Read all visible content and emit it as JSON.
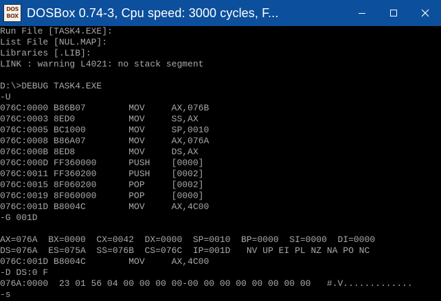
{
  "window": {
    "title": "DOSBox 0.74-3, Cpu speed:      3000 cycles, F...",
    "icon_top": "DOS",
    "icon_bottom": "BOX",
    "icon_name": "dosbox-icon",
    "controls": [
      "minimize-icon",
      "maximize-icon",
      "close-icon"
    ]
  },
  "console": {
    "lines": [
      "Run File [TASK4.EXE]:",
      "List File [NUL.MAP]:",
      "Libraries [.LIB]:",
      "LINK : warning L4021: no stack segment",
      "",
      "D:\\>DEBUG TASK4.EXE",
      "-U",
      "076C:0000 B86B07        MOV     AX,076B",
      "076C:0003 8ED0          MOV     SS,AX",
      "076C:0005 BC1000        MOV     SP,0010",
      "076C:0008 B86A07        MOV     AX,076A",
      "076C:000B 8ED8          MOV     DS,AX",
      "076C:000D FF360000      PUSH    [0000]",
      "076C:0011 FF360200      PUSH    [0002]",
      "076C:0015 8F060200      POP     [0002]",
      "076C:0019 8F060000      POP     [0000]",
      "076C:001D B8004C        MOV     AX,4C00",
      "-G 001D",
      "",
      "AX=076A  BX=0000  CX=0042  DX=0000  SP=0010  BP=0000  SI=0000  DI=0000",
      "DS=076A  ES=075A  SS=076B  CS=076C  IP=001D   NV UP EI PL NZ NA PO NC",
      "076C:001D B8004C        MOV     AX,4C00",
      "-D DS:0 F",
      "076A:0000  23 01 56 04 00 00 00 00-00 00 00 00 00 00 00 00   #.V.............",
      "-s"
    ]
  },
  "colors": {
    "titlebar": "#0c4f9c",
    "console_bg": "#000000",
    "console_text": "#a8a8a8"
  }
}
